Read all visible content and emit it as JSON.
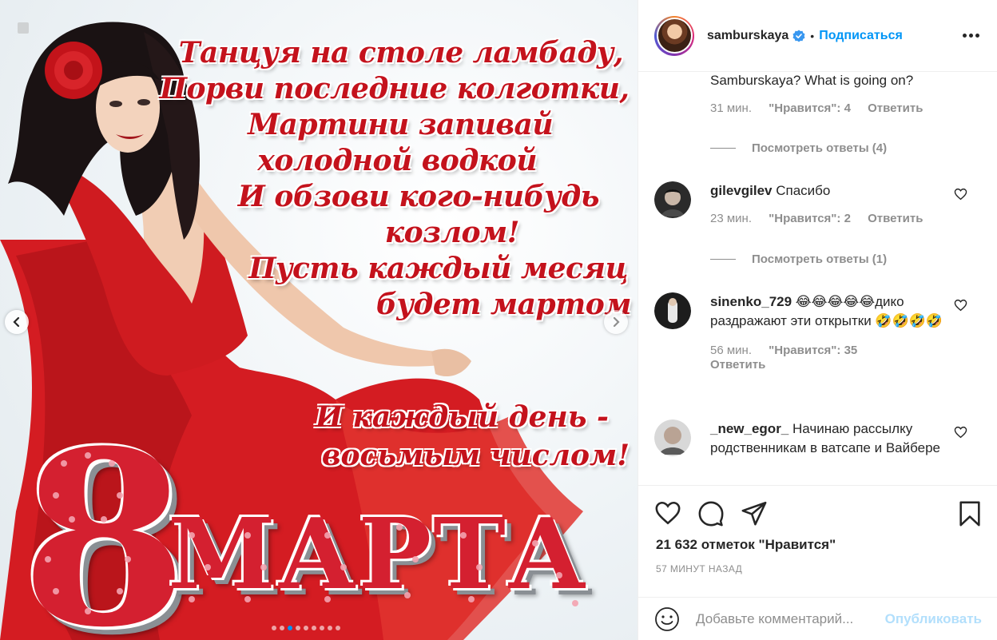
{
  "post": {
    "image": {
      "poem_lines": [
        "Танцуя на столе ламбаду,",
        "Порви последние колготки,",
        "Мартини запивай",
        "холодной водкой",
        "И обзови кого-нибудь",
        "козлом!",
        "Пусть каждый месяц",
        "будет мартом"
      ],
      "poem_end": [
        "И каждый день -",
        "восьмым числом!"
      ],
      "big_number": "8",
      "month": "МАРТА",
      "carousel_count": 9,
      "carousel_active": 3
    },
    "header": {
      "username": "samburskaya",
      "separator": "•",
      "follow_label": "Подписаться"
    },
    "comments": [
      {
        "user": "",
        "text": "Samburskaya? What is going on?",
        "time": "31 мин.",
        "likes": "\"Нравится\": 4",
        "reply": "Ответить",
        "view_replies": "Посмотреть ответы (4)"
      },
      {
        "user": "gilevgilev",
        "text": "Спасибо",
        "time": "23 мин.",
        "likes": "\"Нравится\": 2",
        "reply": "Ответить",
        "view_replies": "Посмотреть ответы (1)"
      },
      {
        "user": "sinenko_729",
        "text": "😂😂😂😂😂дико раздражают эти открытки 🤣🤣🤣🤣",
        "time": "56 мин.",
        "likes": "\"Нравится\": 35",
        "reply": "Ответить"
      },
      {
        "user": "_new_egor_",
        "text": "Начинаю рассылку родственникам в ватсапе и Вайбере"
      }
    ],
    "likes_count": "21 632 отметок \"Нравится\"",
    "posted_ago": "57 МИНУТ НАЗАД",
    "composer": {
      "placeholder": "Добавьте комментарий...",
      "publish_label": "Опубликовать"
    }
  },
  "colors": {
    "accent": "#0095f6",
    "text": "#262626",
    "muted": "#8e8e8e",
    "card_red": "#d42030"
  },
  "icons": [
    "chevron-left-icon",
    "chevron-right-icon",
    "verified-badge-icon",
    "more-icon",
    "heart-icon",
    "comment-icon",
    "share-icon",
    "bookmark-icon",
    "emoji-icon"
  ]
}
